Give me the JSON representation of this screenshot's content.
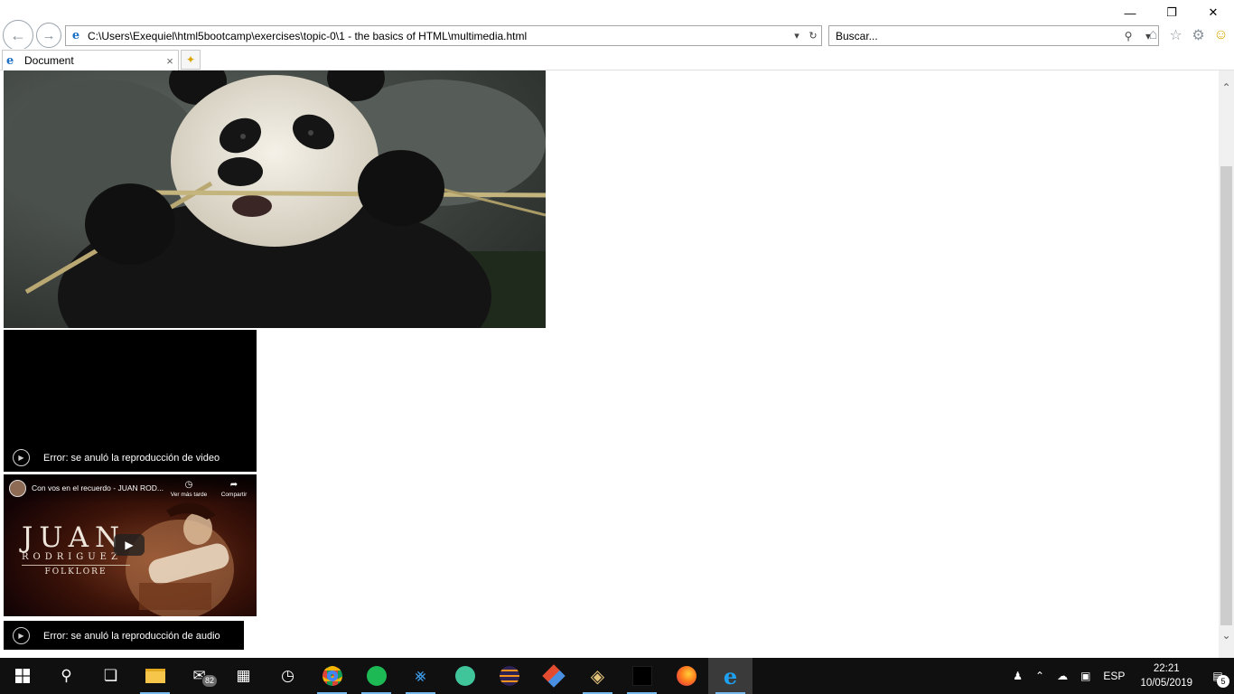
{
  "window": {
    "minimize_glyph": "—",
    "restore_glyph": "❐",
    "close_glyph": "✕"
  },
  "address": {
    "url": "C:\\Users\\Exequiel\\html5bootcamp\\exercises\\topic-0\\1 - the basics of HTML\\multimedia.html"
  },
  "search": {
    "placeholder": "Buscar..."
  },
  "tab": {
    "label": "Document"
  },
  "video": {
    "error_text": "Error: se anuló la reproducción de video"
  },
  "youtube": {
    "title": "Con vos en el recuerdo - JUAN ROD...",
    "watch_later": "Ver más tarde",
    "share": "Compartir",
    "brand_line1": "JUAN",
    "brand_line2": "RODRIGUEZ",
    "brand_line3": "FOLKLORE"
  },
  "audio": {
    "error_text": "Error: se anuló la reproducción de audio"
  },
  "taskbar": {
    "mail_badge": "82",
    "language": "ESP",
    "time": "22:21",
    "date": "10/05/2019",
    "notifications_count": "5"
  },
  "colors": {
    "accent": "#1c6fc6",
    "taskbar": "#101010",
    "running_indicator": "#76b9ed"
  }
}
